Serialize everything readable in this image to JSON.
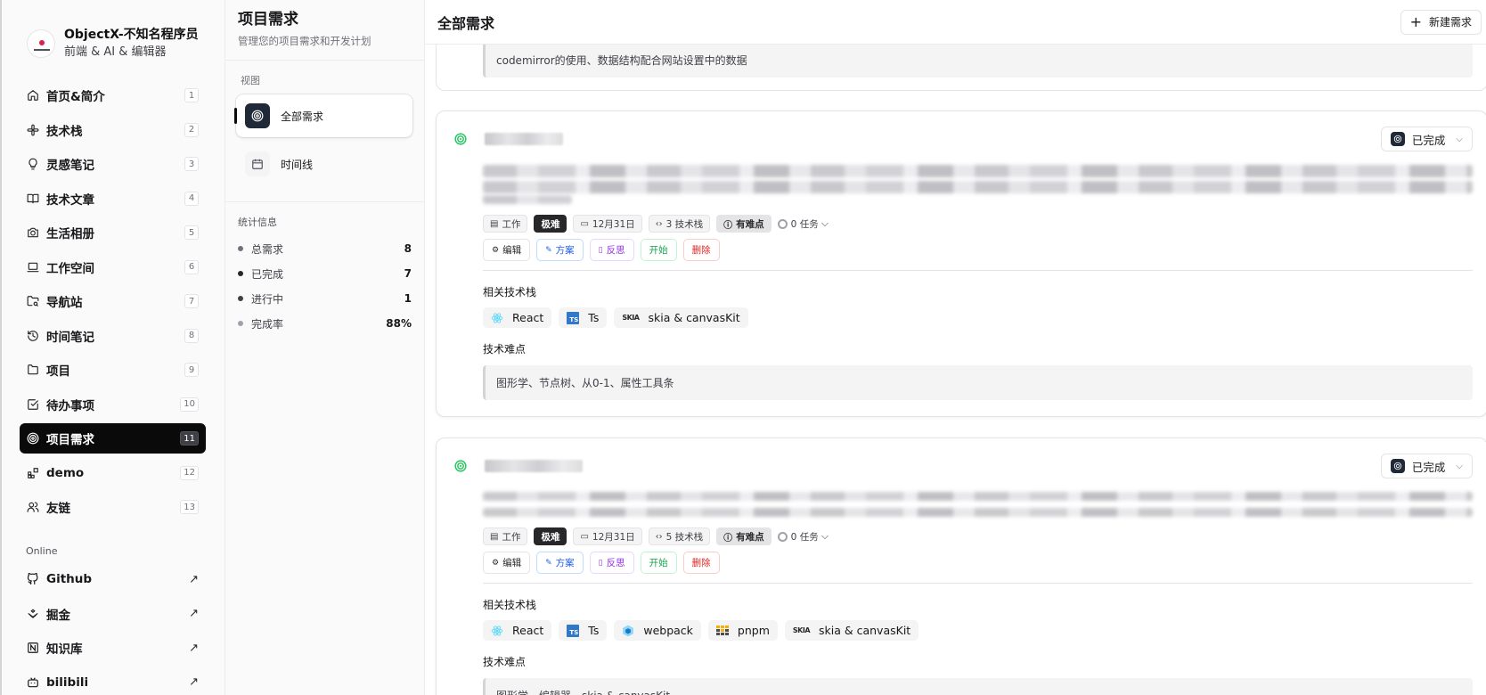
{
  "profile": {
    "name": "ObjectX-不知名程序员",
    "subtitle": "前端 & AI & 编辑器"
  },
  "nav": [
    {
      "label": "首页&简介",
      "num": "1",
      "icon": "home-icon"
    },
    {
      "label": "技术栈",
      "num": "2",
      "icon": "slack-icon"
    },
    {
      "label": "灵感笔记",
      "num": "3",
      "icon": "lightbulb-icon"
    },
    {
      "label": "技术文章",
      "num": "4",
      "icon": "book-open-icon"
    },
    {
      "label": "生活相册",
      "num": "5",
      "icon": "camera-icon"
    },
    {
      "label": "工作空间",
      "num": "6",
      "icon": "laptop-icon"
    },
    {
      "label": "导航站",
      "num": "7",
      "icon": "folder-search-icon"
    },
    {
      "label": "时间笔记",
      "num": "8",
      "icon": "history-icon"
    },
    {
      "label": "项目",
      "num": "9",
      "icon": "folder-icon"
    },
    {
      "label": "待办事项",
      "num": "10",
      "icon": "check-square-icon"
    },
    {
      "label": "项目需求",
      "num": "11",
      "icon": "target-icon"
    },
    {
      "label": "demo",
      "num": "12",
      "icon": "blocks-icon"
    },
    {
      "label": "友链",
      "num": "13",
      "icon": "users-icon"
    }
  ],
  "online": {
    "title": "Online",
    "items": [
      {
        "label": "Github",
        "icon": "github-icon"
      },
      {
        "label": "掘金",
        "icon": "juejin-icon"
      },
      {
        "label": "知识库",
        "icon": "notion-icon"
      },
      {
        "label": "bilibili",
        "icon": "bilibili-icon"
      }
    ]
  },
  "mid": {
    "title": "项目需求",
    "subtitle": "管理您的项目需求和开发计划",
    "view_label": "视图",
    "views": [
      {
        "label": "全部需求"
      },
      {
        "label": "时间线"
      }
    ],
    "stats_title": "统计信息",
    "stats": [
      {
        "label": "总需求",
        "value": "8",
        "color": "#71717a"
      },
      {
        "label": "已完成",
        "value": "7",
        "color": "#27272a"
      },
      {
        "label": "进行中",
        "value": "1",
        "color": "#3f3f46"
      },
      {
        "label": "完成率",
        "value": "88%",
        "color": "#a1a1aa"
      }
    ]
  },
  "main": {
    "title": "全部需求",
    "new_button": "新建需求",
    "card1": {
      "difficulty": "codemirror的使用、数据结构配合网站设置中的数据"
    },
    "card2": {
      "status": "已完成",
      "chips": {
        "type": "工作",
        "level": "极难",
        "date": "12月31日",
        "tech": "3 技术栈",
        "hard": "有难点",
        "tasks": "0 任务"
      },
      "actions": {
        "edit": "编辑",
        "plan": "方案",
        "reflect": "反思",
        "start": "开始",
        "delete": "删除"
      },
      "tech_title": "相关技术栈",
      "tech": [
        "React",
        "Ts",
        "skia & canvasKit"
      ],
      "difficulty_title": "技术难点",
      "difficulty": "图形学、节点树、从0-1、属性工具条"
    },
    "card3": {
      "status": "已完成",
      "chips": {
        "type": "工作",
        "level": "极难",
        "date": "12月31日",
        "tech": "5 技术栈",
        "hard": "有难点",
        "tasks": "0 任务"
      },
      "actions": {
        "edit": "编辑",
        "plan": "方案",
        "reflect": "反思",
        "start": "开始",
        "delete": "删除"
      },
      "tech_title": "相关技术栈",
      "tech": [
        "React",
        "Ts",
        "webpack",
        "pnpm",
        "skia & canvasKit"
      ],
      "difficulty_title": "技术难点",
      "difficulty": "图形学、编辑器、skia & canvasKit"
    }
  }
}
